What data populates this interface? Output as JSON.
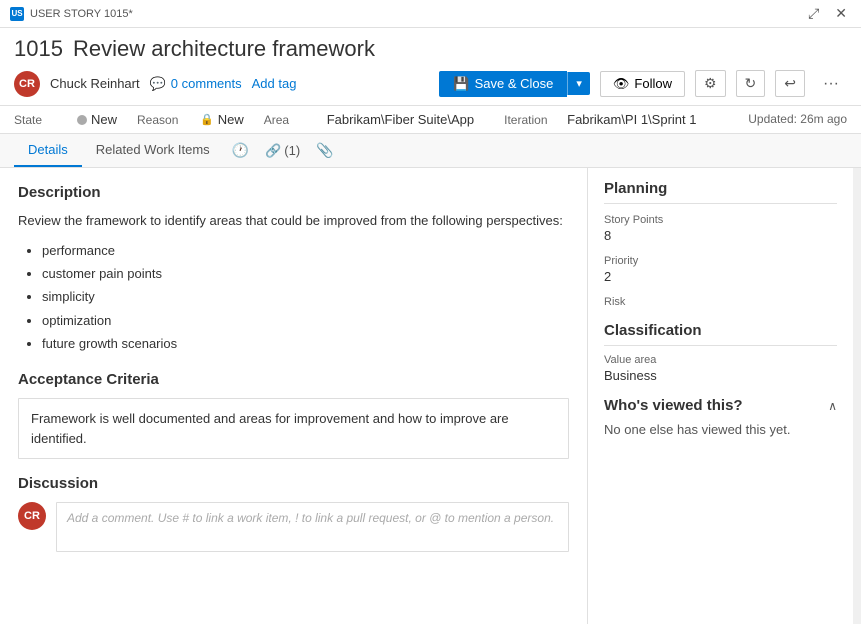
{
  "titleBar": {
    "label": "USER STORY 1015*",
    "expandIcon": "⤢",
    "closeIcon": "✕"
  },
  "header": {
    "workItemId": "1015",
    "workItemTitle": "Review architecture framework",
    "author": {
      "initials": "CR",
      "name": "Chuck Reinhart"
    },
    "comments": {
      "icon": "💬",
      "count": "0 comments"
    },
    "addTag": "Add tag",
    "saveClose": "Save & Close",
    "follow": "Follow",
    "settingsIcon": "⚙",
    "refreshIcon": "↻",
    "undoIcon": "↩",
    "moreIcon": "···"
  },
  "fields": {
    "state": {
      "label": "State",
      "value": "New"
    },
    "reason": {
      "label": "Reason",
      "value": "New"
    },
    "area": {
      "label": "Area",
      "value": "Fabrikam\\Fiber Suite\\App"
    },
    "iteration": {
      "label": "Iteration",
      "value": "Fabrikam\\PI 1\\Sprint 1"
    },
    "updated": "Updated: 26m ago"
  },
  "tabs": {
    "details": "Details",
    "relatedWorkItems": "Related Work Items",
    "historyIcon": "🕐",
    "links": "(1)",
    "attachIcon": "📎"
  },
  "leftPanel": {
    "description": {
      "title": "Description",
      "text": "Review the framework to identify areas that could be improved from the following perspectives:",
      "bullets": [
        "performance",
        "customer pain points",
        "simplicity",
        "optimization",
        "future growth scenarios"
      ]
    },
    "acceptanceCriteria": {
      "title": "Acceptance Criteria",
      "text": "Framework is well documented and areas for improvement and how to improve are identified."
    },
    "discussion": {
      "title": "Discussion",
      "commentPlaceholder": "Add a comment. Use # to link a work item, ! to link a pull request, or @ to mention a person.",
      "avatarInitials": "CR"
    }
  },
  "rightPanel": {
    "planning": {
      "title": "Planning",
      "storyPoints": {
        "label": "Story Points",
        "value": "8"
      },
      "priority": {
        "label": "Priority",
        "value": "2"
      },
      "risk": {
        "label": "Risk",
        "value": ""
      }
    },
    "classification": {
      "title": "Classification",
      "valueArea": {
        "label": "Value area",
        "value": "Business"
      }
    },
    "whosViewed": {
      "title": "Who's viewed this?",
      "text": "No one else has viewed this yet.",
      "chevron": "∧"
    }
  }
}
